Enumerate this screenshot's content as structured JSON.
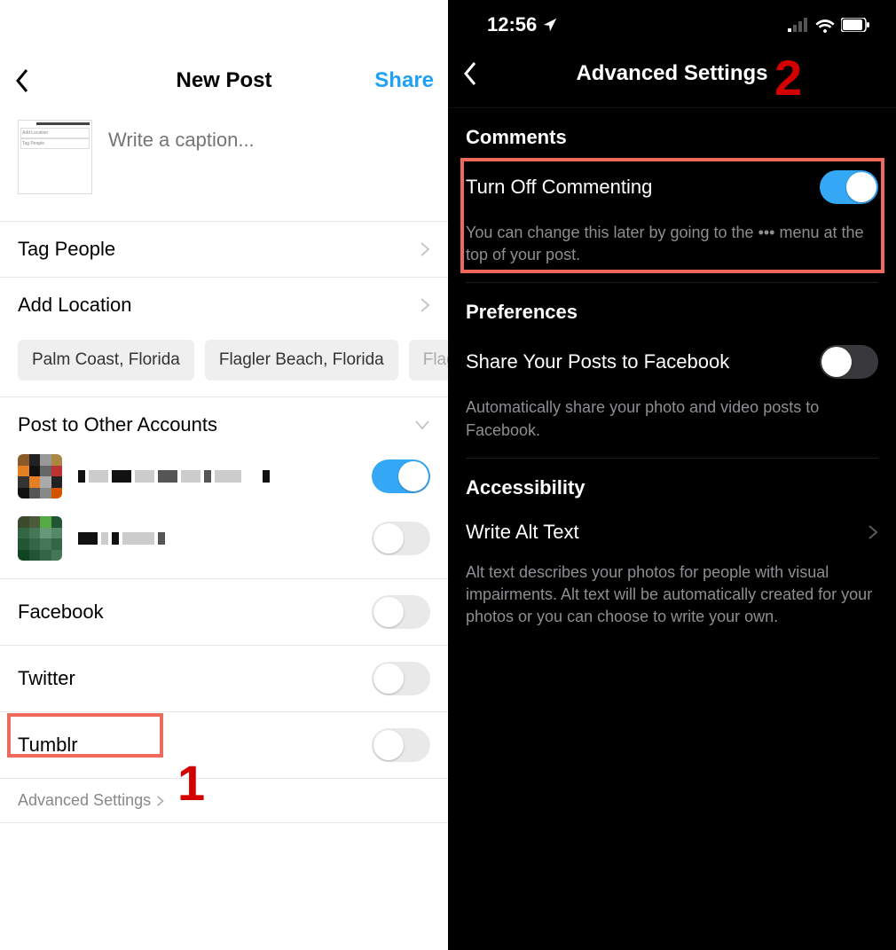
{
  "left": {
    "title": "New Post",
    "share_label": "Share",
    "caption_placeholder": "Write a caption...",
    "tag_people": "Tag People",
    "add_location": "Add Location",
    "location_chips": [
      "Palm Coast, Florida",
      "Flagler Beach, Florida",
      "Flagler"
    ],
    "post_other_accounts": "Post to Other Accounts",
    "services": {
      "facebook": "Facebook",
      "twitter": "Twitter",
      "tumblr": "Tumblr"
    },
    "advanced_settings": "Advanced Settings",
    "callout": "1"
  },
  "right": {
    "time": "12:56",
    "title": "Advanced Settings",
    "comments": {
      "header": "Comments",
      "turn_off": "Turn Off Commenting",
      "desc": "You can change this later by going to the ••• menu at the top of your post."
    },
    "preferences": {
      "header": "Preferences",
      "share_fb": "Share Your Posts to Facebook",
      "desc": "Automatically share your photo and video posts to Facebook."
    },
    "accessibility": {
      "header": "Accessibility",
      "alt_text": "Write Alt Text",
      "desc": "Alt text describes your photos for people with visual impairments. Alt text will be automatically created for your photos or you can choose to write your own."
    },
    "callout": "2"
  }
}
